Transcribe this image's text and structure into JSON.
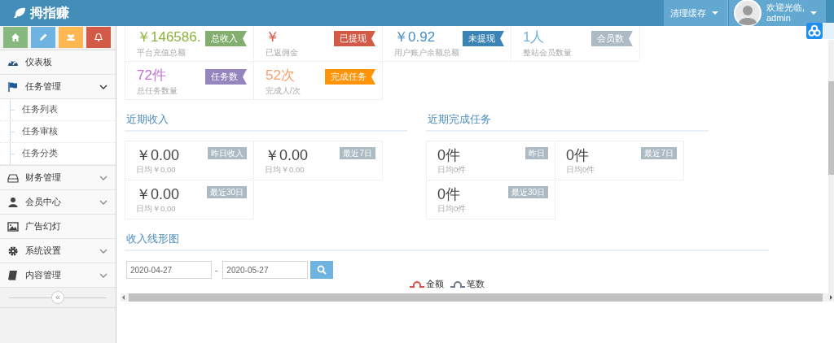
{
  "header": {
    "logo": "拇指赚",
    "clear_cache": "清理缓存",
    "user": {
      "greeting": "欢迎光临,",
      "name": "admin"
    }
  },
  "shortcuts": [
    {
      "kind": "home",
      "color": "#87b87f"
    },
    {
      "kind": "pencil",
      "color": "#6fb3e0"
    },
    {
      "kind": "users",
      "color": "#ffb752"
    },
    {
      "kind": "bell",
      "color": "#d15b47"
    }
  ],
  "sidebar": {
    "items": [
      {
        "label": "仪表板",
        "kind": "dashboard"
      },
      {
        "label": "任务管理",
        "kind": "flag",
        "expanded": true,
        "children": [
          {
            "label": "任务列表"
          },
          {
            "label": "任务审核"
          },
          {
            "label": "任务分类"
          }
        ]
      },
      {
        "label": "财务管理",
        "kind": "drive",
        "expanded": false
      },
      {
        "label": "会员中心",
        "kind": "user",
        "expanded": false
      },
      {
        "label": "广告幻灯",
        "kind": "image"
      },
      {
        "label": "系统设置",
        "kind": "gear",
        "expanded": false
      },
      {
        "label": "内容管理",
        "kind": "book",
        "expanded": false
      }
    ],
    "collapse": "«"
  },
  "stats": [
    {
      "value": {
        "text": "￥146586.",
        "color": "#8db33c"
      },
      "label": "平台充值总额",
      "badge": {
        "text": "总收入",
        "color": "#82af6f"
      }
    },
    {
      "value": {
        "text": "￥",
        "color": "#dd4b39"
      },
      "label": "已返佣金",
      "badge": {
        "text": "已提现",
        "color": "#d15b47"
      }
    },
    {
      "value": {
        "text": "￥0.92",
        "color": "#478fca"
      },
      "label": "用户账户余额总额",
      "badge": {
        "text": "未提现",
        "color": "#3983b5"
      }
    },
    {
      "value": {
        "text": "1人",
        "color": "#6fb3e0"
      },
      "label": "整站会员数量",
      "badge": {
        "text": "会员数",
        "color": "#abbac3"
      }
    },
    {
      "value": {
        "text": "72件",
        "color": "#c070d6"
      },
      "label": "总任务数量",
      "badge": {
        "text": "任务数",
        "color": "#9585bf"
      }
    },
    {
      "value": {
        "text": "52次",
        "color": "#f4a06c"
      },
      "label": "完成人/次",
      "badge": {
        "text": "完成任务",
        "color": "#ff9409"
      }
    }
  ],
  "sections": [
    {
      "title": "近期收入",
      "cards": [
        {
          "value": "￥0.00",
          "sub": "日均￥0.00",
          "badge": "昨日收入"
        },
        {
          "value": "￥0.00",
          "sub": "日均￥0.00",
          "badge": "最近7日"
        },
        {
          "value": "￥0.00",
          "sub": "日均￥0.00",
          "badge": "最近30日"
        }
      ]
    },
    {
      "title": "近期完成任务",
      "cards": [
        {
          "value": "0件",
          "sub": "日均0件",
          "badge": "昨日"
        },
        {
          "value": "0件",
          "sub": "日均0件",
          "badge": "最近7日"
        },
        {
          "value": "0件",
          "sub": "日均0件",
          "badge": "最近30日"
        }
      ]
    }
  ],
  "chart_section": {
    "title": "收入线形图",
    "date_from": "2020-04-27",
    "separator": "-",
    "date_to": "2020-05-27",
    "legend": [
      {
        "label": "金额",
        "color": "#e0504a"
      },
      {
        "label": "笔数",
        "color": "#6d7b8a"
      }
    ]
  }
}
